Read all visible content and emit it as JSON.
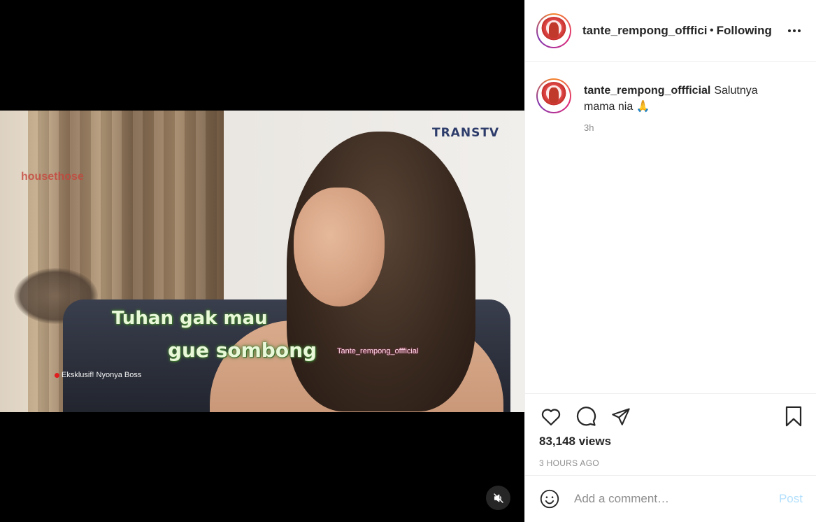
{
  "video": {
    "channel_logo": "TRANSTV",
    "corner_logo": "housethose",
    "subtitle_line1": "Tuhan gak mau",
    "subtitle_line2": "gue sombong",
    "watermark": "Tante_rempong_offficial",
    "caption_tag": "Eksklusif! Nyonya Boss",
    "mute_icon": "speaker-muted-icon"
  },
  "header": {
    "username": "tante_rempong_offficial",
    "separator": "•",
    "follow_status": "Following",
    "more_icon": "more-horizontal-icon"
  },
  "caption": {
    "username": "tante_rempong_offficial",
    "text": "Salutnya mama nia 🙏",
    "time": "3h"
  },
  "actions": {
    "like_icon": "heart-icon",
    "comment_icon": "comment-bubble-icon",
    "share_icon": "paper-plane-icon",
    "save_icon": "bookmark-icon",
    "views": "83,148 views",
    "posted": "3 HOURS AGO"
  },
  "add_comment": {
    "emoji_icon": "smiley-icon",
    "placeholder": "Add a comment…",
    "post_label": "Post"
  },
  "colors": {
    "post_disabled": "#b2dffc",
    "meta_gray": "#8e8e8e",
    "text_dark": "#262626"
  }
}
